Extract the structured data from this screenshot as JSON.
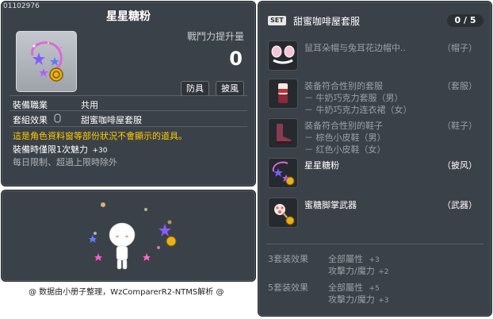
{
  "item": {
    "code": "01102976",
    "name": "星星糖粉",
    "power_label": "戰鬥力提升量",
    "power_value": "0",
    "tags": [
      "防具",
      "披風"
    ],
    "job_label": "裝備職業",
    "job_value": "共用",
    "set_label": "套組效果",
    "set_value": "甜蜜咖啡屋套服",
    "notice": "這是角色資料窗等部份狀況不會顯示的道具。",
    "charm_text": "裝備時僅限1次魅力",
    "charm_value": "+30",
    "limit_text": "每日限制、超過上限時除外"
  },
  "set": {
    "badge": "SET",
    "name": "甜蜜咖啡屋套服",
    "count": "0 / 5",
    "items": [
      {
        "name": "鼠耳朵帽与兔耳花边帽中..",
        "sub": [],
        "type": "（帽子）",
        "icon": "ear-hat-icon",
        "dim": true
      },
      {
        "name": "装备符合性别的套服",
        "sub": [
          "－ 牛奶巧克力套服（男）",
          "－ 牛奶巧克力连衣裙（女）"
        ],
        "type": "（套服）",
        "icon": "outfit-icon",
        "dim": true
      },
      {
        "name": "装备符合性别的鞋子",
        "sub": [
          "－ 棕色小皮鞋（男）",
          "－ 红色小皮鞋（女）"
        ],
        "type": "（鞋子）",
        "icon": "shoes-icon",
        "dim": true
      },
      {
        "name": "星星糖粉",
        "sub": [],
        "type": "（披风）",
        "icon": "star-cape-icon",
        "dim": false
      },
      {
        "name": "蜜糖脚掌武器",
        "sub": [],
        "type": "（武器）",
        "icon": "paw-weapon-icon",
        "dim": false
      }
    ],
    "effects": [
      {
        "label": "3套装效果",
        "lines": [
          {
            "text": "全部屬性",
            "val": "+3"
          },
          {
            "text": "攻擊力/魔力",
            "val": "+2"
          }
        ]
      },
      {
        "label": "5套装效果",
        "lines": [
          {
            "text": "全部屬性",
            "val": "+5"
          },
          {
            "text": "攻擊力/魔力",
            "val": "+3"
          }
        ]
      }
    ]
  },
  "footer": "@ 数据由小册子整理，WzComparerR2-NTMS解析 @",
  "colors": {
    "panel": "#3b4148",
    "notice": "#ffcc00",
    "dim": "#9aa0a6"
  }
}
